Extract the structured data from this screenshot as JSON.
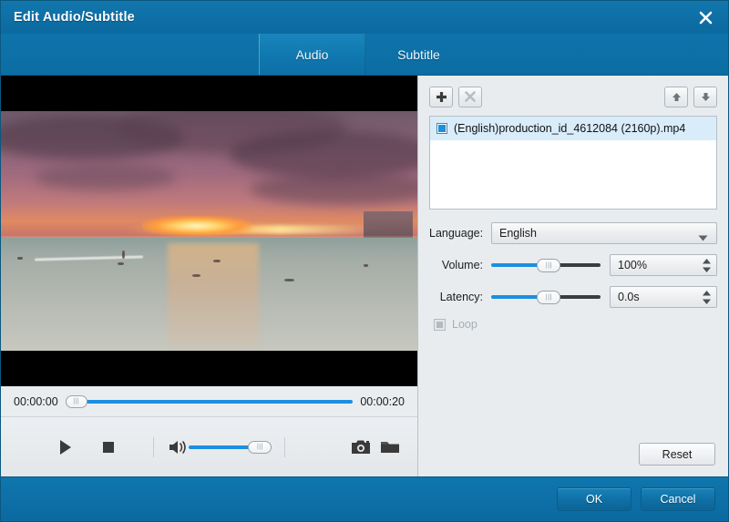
{
  "window": {
    "title": "Edit Audio/Subtitle",
    "close_icon": "close-icon"
  },
  "tabs": [
    {
      "label": "Audio",
      "active": true
    },
    {
      "label": "Subtitle",
      "active": false
    }
  ],
  "player": {
    "current_time": "00:00:00",
    "total_time": "00:00:20",
    "seek_percent": 0,
    "volume_percent": 100,
    "controls": {
      "play_icon": "play-icon",
      "stop_icon": "stop-icon",
      "speaker_icon": "speaker-icon",
      "snapshot_icon": "camera-icon",
      "open_folder_icon": "folder-icon"
    },
    "preview_alt": "sunset ocean beach with surfers"
  },
  "track_panel": {
    "add_label": "+",
    "remove_label": "×",
    "move_up_icon": "arrow-up-icon",
    "move_down_icon": "arrow-down-icon",
    "tracks": [
      {
        "name": "(English)production_id_4612084 (2160p).mp4",
        "checked": true,
        "selected": true
      }
    ]
  },
  "form": {
    "language": {
      "label": "Language:",
      "value": "English",
      "options": [
        "English"
      ]
    },
    "volume": {
      "label": "Volume:",
      "value": "100%",
      "slider_percent": 47
    },
    "latency": {
      "label": "Latency:",
      "value": "0.0s",
      "slider_percent": 47
    },
    "loop": {
      "label": "Loop",
      "checked": true,
      "disabled": true
    },
    "reset_label": "Reset"
  },
  "footer": {
    "ok_label": "OK",
    "cancel_label": "Cancel"
  },
  "colors": {
    "titlebar_blue": "#0d6fa5",
    "accent_blue": "#1b8fe0",
    "panel_gray": "#e8ecef",
    "selection_blue": "#d9ecfa"
  }
}
